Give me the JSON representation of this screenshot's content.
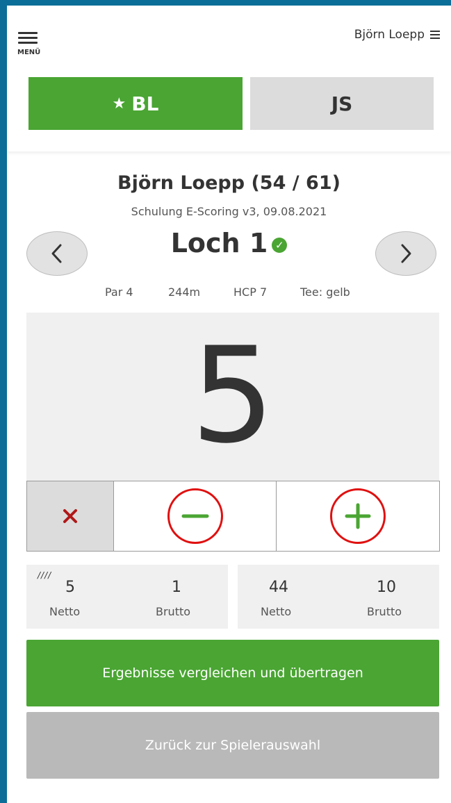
{
  "header": {
    "menu_label": "MENÜ",
    "user_name": "Björn Loepp"
  },
  "player_tabs": [
    {
      "label": "BL",
      "active": true,
      "starred": true
    },
    {
      "label": "JS",
      "active": false
    }
  ],
  "player": {
    "title": "Björn Loepp (54 / 61)",
    "round": "Schulung E-Scoring v3, 09.08.2021"
  },
  "hole": {
    "title": "Loch 1",
    "par": "Par 4",
    "distance": "244m",
    "hcp": "HCP 7",
    "tee": "Tee: gelb"
  },
  "score": "5",
  "totals": {
    "tally": "////",
    "left": {
      "netto": "5",
      "brutto": "1",
      "netto_label": "Netto",
      "brutto_label": "Brutto"
    },
    "right": {
      "netto": "44",
      "brutto": "10",
      "netto_label": "Netto",
      "brutto_label": "Brutto"
    }
  },
  "buttons": {
    "compare": "Ergebnisse vergleichen und übertragen",
    "back": "Zurück zur Spielerauswahl"
  },
  "colors": {
    "accent_green": "#4aa533",
    "frame_blue": "#0a6e98",
    "highlight_red": "#e01010",
    "delete_red": "#b01818"
  },
  "icons": {
    "menu": "hamburger-icon",
    "user_menu": "hamburger-icon",
    "star": "star-icon",
    "check": "check-circle-icon",
    "prev": "chevron-left-icon",
    "next": "chevron-right-icon",
    "delete": "close-icon",
    "minus": "minus-icon",
    "plus": "plus-icon"
  }
}
